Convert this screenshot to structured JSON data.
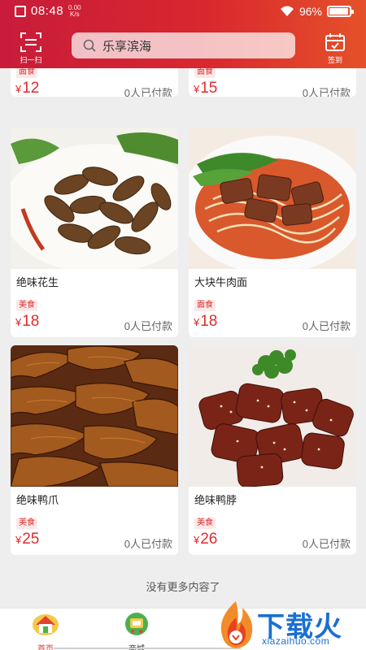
{
  "status_bar": {
    "time": "08:48",
    "network_speed": "0.00",
    "network_unit": "K/s",
    "battery": "96%",
    "battery_level": 0.96
  },
  "header": {
    "scan_label": "扫一扫",
    "search_text": "乐享滨海",
    "signin_label": "签到",
    "gradient": [
      "#c81c3a",
      "#e5512a"
    ]
  },
  "products_partial": [
    {
      "badge": "面食",
      "currency": "¥",
      "price": "12",
      "paid": "0人已付款"
    },
    {
      "badge": "面食",
      "currency": "¥",
      "price": "15",
      "paid": "0人已付款"
    }
  ],
  "products": [
    {
      "name": "绝味花生",
      "badge": "美食",
      "currency": "¥",
      "price": "18",
      "paid": "0人已付款",
      "image": "braised-peanuts-image"
    },
    {
      "name": "大块牛肉面",
      "badge": "面食",
      "currency": "¥",
      "price": "18",
      "paid": "0人已付款",
      "image": "beef-noodles-image"
    },
    {
      "name": "绝味鸭爪",
      "badge": "美食",
      "currency": "¥",
      "price": "25",
      "paid": "0人已付款",
      "image": "duck-feet-image"
    },
    {
      "name": "绝味鸭脖",
      "badge": "美食",
      "currency": "¥",
      "price": "26",
      "paid": "0人已付款",
      "image": "duck-neck-image"
    }
  ],
  "feed_end_text": "没有更多内容了",
  "tabbar": {
    "home_label": "首页",
    "mall_label": "商城"
  },
  "watermark": {
    "main": "下载火",
    "sub": "xiazaihuo.com"
  },
  "colors": {
    "accent": "#e02c2c",
    "badge_bg": "#fde8e8",
    "watermark": "#1a6fd1"
  }
}
